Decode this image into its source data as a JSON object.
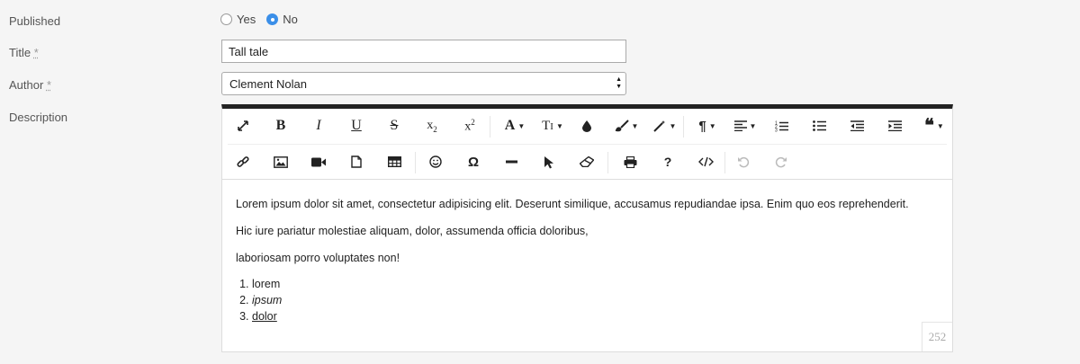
{
  "form": {
    "published": {
      "label": "Published",
      "options": [
        {
          "label": "Yes",
          "checked": false
        },
        {
          "label": "No",
          "checked": true
        }
      ]
    },
    "title": {
      "label": "Title",
      "required_mark": "*",
      "value": "Tall tale"
    },
    "author": {
      "label": "Author",
      "required_mark": "*",
      "value": "Clement Nolan"
    },
    "description": {
      "label": "Description"
    }
  },
  "editor": {
    "toolbar_row1": [
      "fullscreen-icon",
      "bold-icon",
      "italic-icon",
      "underline-icon",
      "strikethrough-icon",
      "subscript-icon",
      "superscript-icon",
      "font-family-icon",
      "font-size-icon",
      "color-icon",
      "paint-brush-icon",
      "magic-wand-icon",
      "paragraph-icon",
      "align-icon",
      "ordered-list-icon",
      "unordered-list-icon",
      "outdent-icon",
      "indent-icon",
      "quote-icon"
    ],
    "toolbar_row2": [
      "link-icon",
      "image-icon",
      "video-icon",
      "file-icon",
      "table-icon",
      "emoticon-icon",
      "special-char-icon",
      "horizontal-line-icon",
      "select-all-icon",
      "clear-format-icon",
      "print-icon",
      "help-icon",
      "code-view-icon",
      "undo-icon",
      "redo-icon"
    ],
    "paragraphs": [
      "Lorem ipsum dolor sit amet, consectetur adipisicing elit. Deserunt similique, accusamus repudiandae ipsa. Enim quo eos reprehenderit.",
      "Hic iure pariatur molestiae aliquam, dolor, assumenda officia doloribus,",
      "laboriosam porro voluptates non!"
    ],
    "list": [
      "lorem",
      "ipsum",
      "dolor"
    ],
    "char_count": "252",
    "accent_color": "#222222"
  }
}
